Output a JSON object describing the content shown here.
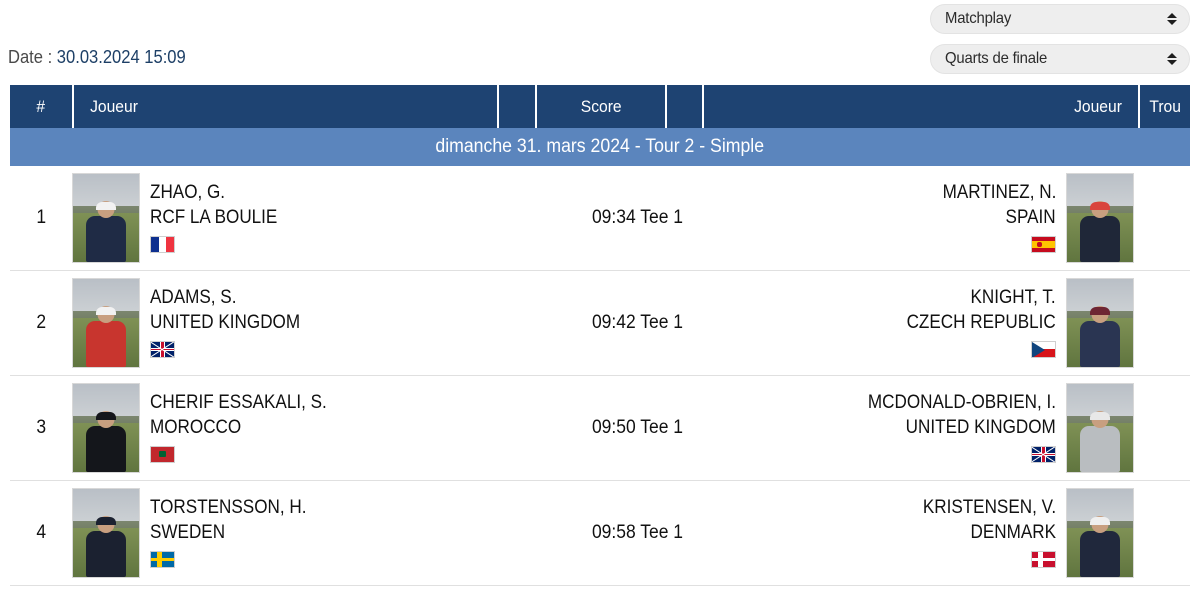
{
  "controls": {
    "format_select": {
      "value": "Matchplay",
      "name": "format-select"
    },
    "stage_select": {
      "value": "Quarts de finale",
      "name": "stage-select"
    }
  },
  "dateline": {
    "label": "Date :",
    "value": "30.03.2024 15:09"
  },
  "table": {
    "headers": {
      "num": "#",
      "player1": "Joueur",
      "score": "Score",
      "player2": "Joueur",
      "hole": "Trou"
    },
    "subheader": "dimanche 31. mars 2024 - Tour 2 - Simple",
    "rows": [
      {
        "num": "1",
        "score": "09:34 Tee 1",
        "hole": "",
        "left": {
          "name": "ZHAO, G.",
          "club": "RCF LA BOULIE",
          "flag": "flag-france",
          "jacket": "#1f2b45",
          "cap": "#f2f2f2"
        },
        "right": {
          "name": "MARTINEZ, N.",
          "club": "SPAIN",
          "flag": "flag-spain",
          "jacket": "#1f2738",
          "cap": "#d9443c"
        }
      },
      {
        "num": "2",
        "score": "09:42 Tee 1",
        "hole": "",
        "left": {
          "name": "ADAMS, S.",
          "club": "UNITED KINGDOM",
          "flag": "flag-uk",
          "jacket": "#c8352e",
          "cap": "#f2f2f2"
        },
        "right": {
          "name": "KNIGHT, T.",
          "club": "CZECH REPUBLIC",
          "flag": "flag-czech",
          "jacket": "#2a3552",
          "cap": "#6e2533"
        }
      },
      {
        "num": "3",
        "score": "09:50 Tee 1",
        "hole": "",
        "left": {
          "name": "CHERIF ESSAKALI, S.",
          "club": "MOROCCO",
          "flag": "flag-morocco",
          "jacket": "#14161b",
          "cap": "#14161b"
        },
        "right": {
          "name": "MCDONALD-OBRIEN, I.",
          "club": "UNITED KINGDOM",
          "flag": "flag-uk",
          "jacket": "#b9bdc0",
          "cap": "#e8e8e8"
        }
      },
      {
        "num": "4",
        "score": "09:58 Tee 1",
        "hole": "",
        "left": {
          "name": "TORSTENSSON, H.",
          "club": "SWEDEN",
          "flag": "flag-sweden",
          "jacket": "#1b2130",
          "cap": "#1b2130"
        },
        "right": {
          "name": "KRISTENSEN, V.",
          "club": "DENMARK",
          "flag": "flag-denmark",
          "jacket": "#20283c",
          "cap": "#efefef"
        }
      }
    ]
  },
  "colors": {
    "header_bg": "#1e4372",
    "subheader_bg": "#5b85bd",
    "date_value": "#1d3f66",
    "row_divider": "#e0e0e0"
  }
}
